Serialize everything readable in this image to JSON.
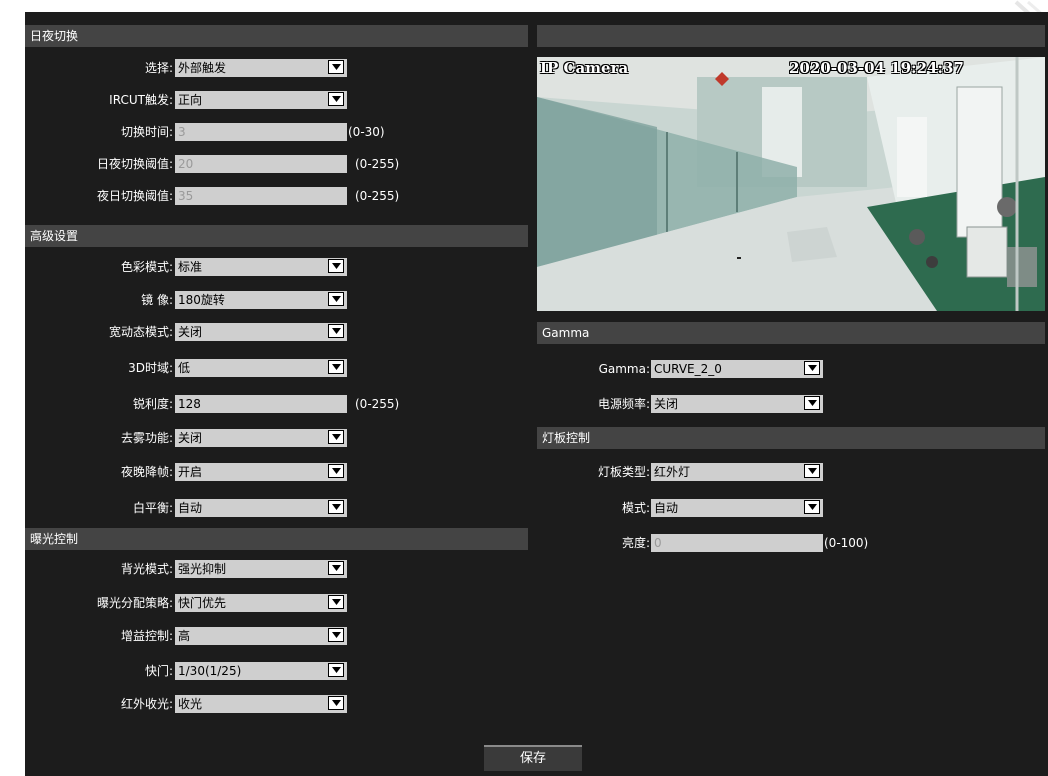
{
  "sections": {
    "daynight": "日夜切换",
    "advanced": "高级设置",
    "exposure": "曝光控制",
    "video_header": "",
    "gamma": "Gamma",
    "lamp": "灯板控制"
  },
  "daynight": {
    "select": {
      "label": "选择:",
      "value": "外部触发"
    },
    "ircut": {
      "label": "IRCUT触发:",
      "value": "正向"
    },
    "switch_time": {
      "label": "切换时间:",
      "value": "3",
      "range": "(0-30)"
    },
    "d2n_threshold": {
      "label": "日夜切换阈值:",
      "value": "20",
      "range": "(0-255)"
    },
    "n2d_threshold": {
      "label": "夜日切换阈值:",
      "value": "35",
      "range": "(0-255)"
    }
  },
  "advanced": {
    "color_mode": {
      "label": "色彩模式:",
      "value": "标准"
    },
    "mirror": {
      "label": "镜 像:",
      "value": "180旋转"
    },
    "wdr_mode": {
      "label": "宽动态模式:",
      "value": "关闭"
    },
    "dnr_3d": {
      "label": "3D时域:",
      "value": "低"
    },
    "sharpness": {
      "label": "锐利度:",
      "value": "128",
      "range": "(0-255)"
    },
    "defog": {
      "label": "去雾功能:",
      "value": "关闭"
    },
    "night_frame": {
      "label": "夜晚降帧:",
      "value": "开启"
    },
    "white_balance": {
      "label": "白平衡:",
      "value": "自动"
    }
  },
  "exposure": {
    "backlight": {
      "label": "背光模式:",
      "value": "强光抑制"
    },
    "strategy": {
      "label": "曝光分配策略:",
      "value": "快门优先"
    },
    "gain": {
      "label": "增益控制:",
      "value": "高"
    },
    "shutter": {
      "label": "快门:",
      "value": "1/30(1/25)"
    },
    "ir_light": {
      "label": "红外收光:",
      "value": "收光"
    }
  },
  "video": {
    "osd_name": "IP Camera",
    "osd_time": "2020-03-04 19:24:37"
  },
  "gamma": {
    "gamma": {
      "label": "Gamma:",
      "value": "CURVE_2_0"
    },
    "power_freq": {
      "label": "电源频率:",
      "value": "关闭"
    }
  },
  "lamp": {
    "type": {
      "label": "灯板类型:",
      "value": "红外灯"
    },
    "mode": {
      "label": "模式:",
      "value": "自动"
    },
    "brightness": {
      "label": "亮度:",
      "value": "0",
      "range": "(0-100)"
    }
  },
  "save_label": "保存",
  "colors": {
    "panel": "#1c1c1c",
    "section": "#444444",
    "field": "#cfcfcf"
  }
}
